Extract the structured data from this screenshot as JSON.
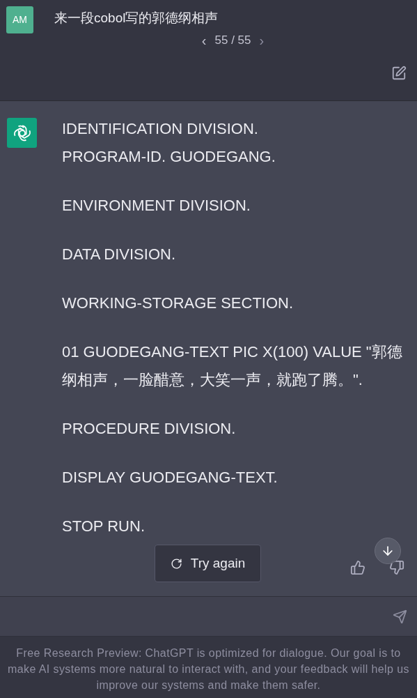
{
  "user_message": {
    "avatar": "AM",
    "text": "来一段cobol写的郭德纲相声",
    "pager": {
      "prev": "‹",
      "count": "55 / 55",
      "next": "›"
    }
  },
  "assistant_message": {
    "paragraphs": [
      [
        "IDENTIFICATION DIVISION.",
        "PROGRAM-ID. GUODEGANG."
      ],
      [
        "ENVIRONMENT DIVISION."
      ],
      [
        "DATA DIVISION."
      ],
      [
        "WORKING-STORAGE SECTION."
      ],
      [
        "01 GUODEGANG-TEXT PIC X(100) VALUE \"郭德纲相声，一脸醋意，大笑一声，就跑了腾。\"."
      ],
      [
        "PROCEDURE DIVISION."
      ],
      [
        "DISPLAY GUODEGANG-TEXT."
      ],
      [
        "STOP RUN."
      ]
    ]
  },
  "try_again_button": {
    "label": "Try again"
  },
  "footer": "Free Research Preview: ChatGPT is optimized for dialogue. Our goal is to make AI systems more natural to interact with, and your feedback will help us improve our systems and make them safer."
}
